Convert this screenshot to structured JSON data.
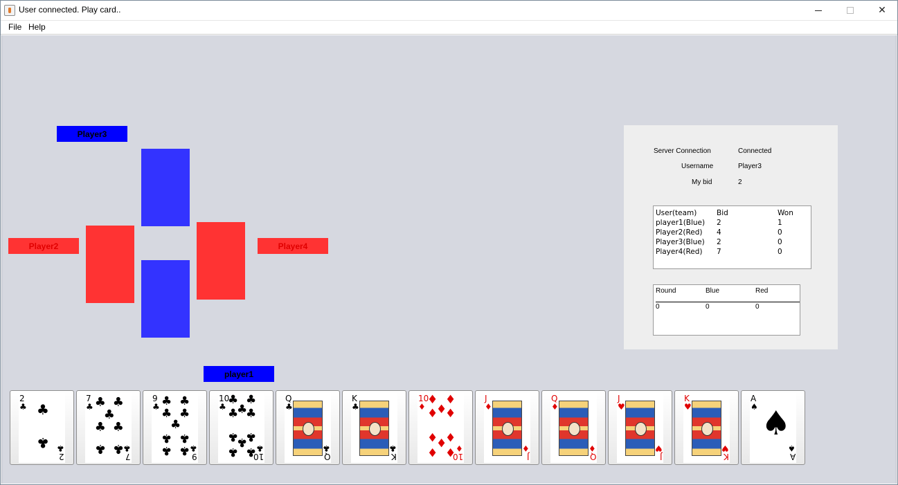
{
  "window": {
    "title": "User connected. Play card..",
    "minimize": "—",
    "close": "✕"
  },
  "menu": {
    "file": "File",
    "help": "Help"
  },
  "players": {
    "player3": {
      "label": "Player3",
      "team_color": "#0000ff"
    },
    "player2": {
      "label": "Player2",
      "team_color": "#ff3333"
    },
    "player4": {
      "label": "Player4",
      "team_color": "#ff3333"
    },
    "player1": {
      "label": "player1",
      "team_color": "#0000ff"
    }
  },
  "info": {
    "server_connection_label": "Server Connection",
    "server_connection_value": "Connected",
    "username_label": "Username",
    "username_value": "Player3",
    "bid_label": "My bid",
    "bid_value": "2"
  },
  "bid_table": {
    "headers": [
      "User(team)",
      "Bid",
      "Won"
    ],
    "rows": [
      [
        "player1(Blue)",
        "2",
        "1"
      ],
      [
        "Player2(Red)",
        "4",
        "0"
      ],
      [
        "Player3(Blue)",
        "2",
        "0"
      ],
      [
        "Player4(Red)",
        "7",
        "0"
      ]
    ]
  },
  "score_table": {
    "headers": [
      "Round",
      "Blue",
      "Red"
    ],
    "rows": [
      [
        "0",
        "0",
        "0"
      ]
    ]
  },
  "hand": [
    {
      "rank": "2",
      "suit": "♣",
      "color": "black"
    },
    {
      "rank": "7",
      "suit": "♣",
      "color": "black"
    },
    {
      "rank": "9",
      "suit": "♣",
      "color": "black"
    },
    {
      "rank": "10",
      "suit": "♣",
      "color": "black"
    },
    {
      "rank": "Q",
      "suit": "♣",
      "color": "black"
    },
    {
      "rank": "K",
      "suit": "♣",
      "color": "black"
    },
    {
      "rank": "10",
      "suit": "♦",
      "color": "red"
    },
    {
      "rank": "J",
      "suit": "♦",
      "color": "red"
    },
    {
      "rank": "Q",
      "suit": "♦",
      "color": "red"
    },
    {
      "rank": "J",
      "suit": "♥",
      "color": "red"
    },
    {
      "rank": "K",
      "suit": "♥",
      "color": "red"
    },
    {
      "rank": "A",
      "suit": "♠",
      "color": "black"
    }
  ]
}
